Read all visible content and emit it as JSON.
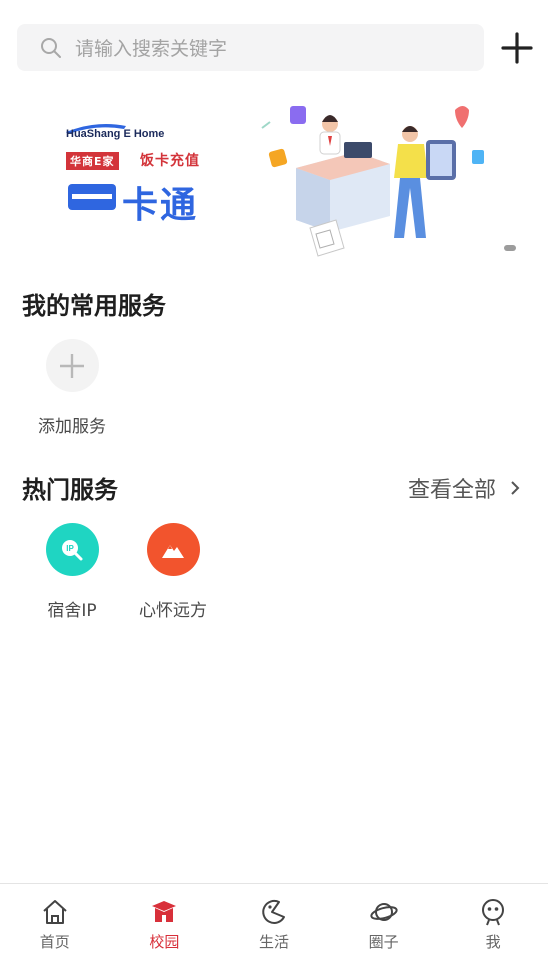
{
  "search": {
    "placeholder": "请输入搜索关键字"
  },
  "banner": {
    "brand": "HuaShang E Home",
    "tag": "华商E家",
    "subtitle": "饭卡充值",
    "title": "卡通"
  },
  "my_services": {
    "title": "我的常用服务",
    "add_label": "添加服务"
  },
  "hot_services": {
    "title": "热门服务",
    "see_all": "查看全部",
    "items": [
      {
        "label": "宿舍IP",
        "icon": "ip-search-icon",
        "color": "#1fd5c2"
      },
      {
        "label": "心怀远方",
        "icon": "mountain-icon",
        "color": "#f2542d"
      }
    ]
  },
  "tabbar": {
    "active": "校园",
    "accent": "#d8303a",
    "items": [
      {
        "label": "首页",
        "icon": "home-icon"
      },
      {
        "label": "校园",
        "icon": "school-icon"
      },
      {
        "label": "生活",
        "icon": "life-icon"
      },
      {
        "label": "圈子",
        "icon": "planet-icon"
      },
      {
        "label": "我",
        "icon": "profile-icon"
      }
    ]
  }
}
